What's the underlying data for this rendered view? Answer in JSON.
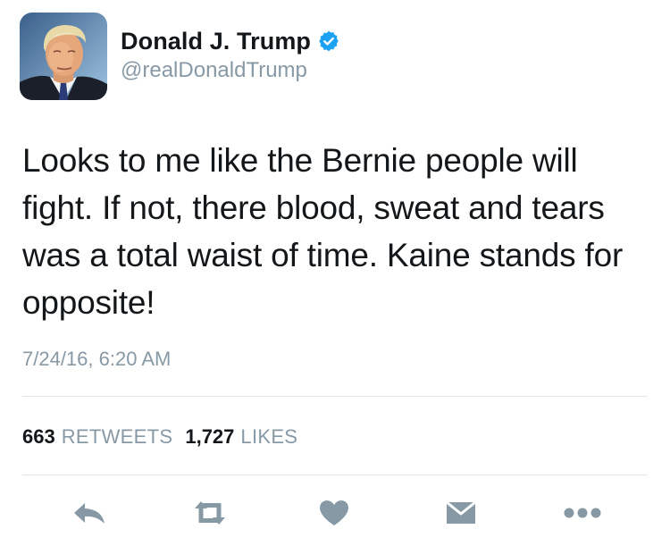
{
  "user": {
    "display_name": "Donald J. Trump",
    "handle": "@realDonaldTrump",
    "verified": true
  },
  "tweet": {
    "text": "Looks to me like the Bernie people will fight. If not, there blood, sweat and tears was a total waist of time. Kaine stands for opposite!",
    "timestamp": "7/24/16, 6:20 AM"
  },
  "stats": {
    "retweets_count": "663",
    "retweets_label": "RETWEETS",
    "likes_count": "1,727",
    "likes_label": "LIKES"
  },
  "actions": [
    "reply-icon",
    "retweet-icon",
    "like-icon",
    "direct-message-icon",
    "more-icon"
  ],
  "colors": {
    "text": "#14171a",
    "secondary": "#8899a6",
    "verified": "#1da1f2",
    "icon": "#8899a6",
    "divider": "#e1e8ed"
  }
}
